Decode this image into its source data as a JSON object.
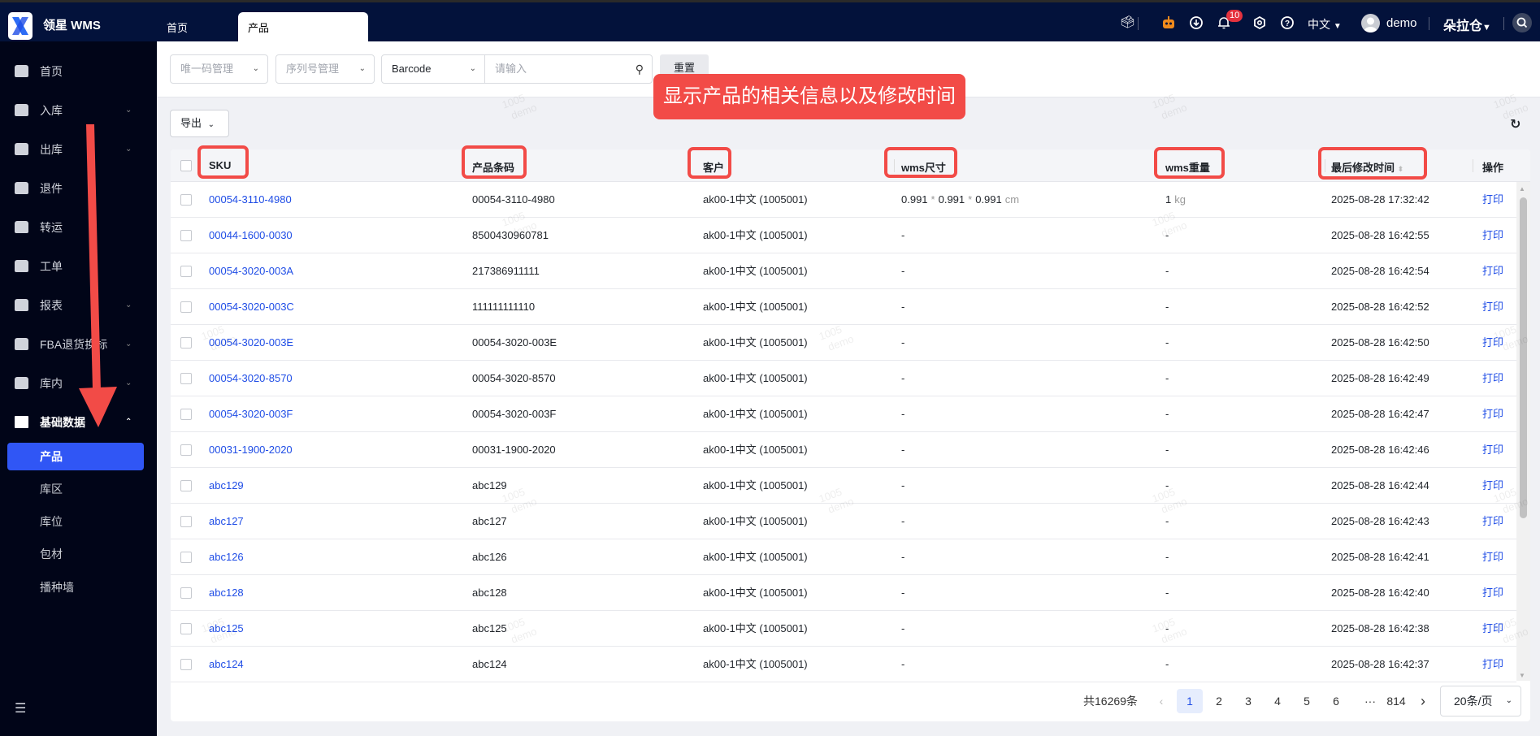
{
  "app": {
    "brand": "领星 WMS"
  },
  "tabs": [
    {
      "label": "首页"
    },
    {
      "label": "产品"
    }
  ],
  "header": {
    "notification_count": "10",
    "language": "中文",
    "username": "demo",
    "warehouse": "朵拉仓",
    "icons": [
      "inbox-icon",
      "robot-icon",
      "download-icon",
      "bell-icon",
      "settings-icon",
      "help-icon",
      "avatar",
      "search-icon"
    ]
  },
  "sidebar": {
    "items": [
      {
        "label": "首页"
      },
      {
        "label": "入库"
      },
      {
        "label": "出库"
      },
      {
        "label": "退件"
      },
      {
        "label": "转运"
      },
      {
        "label": "工单"
      },
      {
        "label": "报表"
      },
      {
        "label": "FBA退货换标"
      },
      {
        "label": "库内"
      },
      {
        "label": "基础数据"
      }
    ],
    "sub_items": [
      {
        "label": "产品"
      },
      {
        "label": "库区"
      },
      {
        "label": "库位"
      },
      {
        "label": "包材"
      },
      {
        "label": "播种墙"
      }
    ]
  },
  "filters": {
    "unique_code": "唯一码管理",
    "serial": "序列号管理",
    "field": "Barcode",
    "search_placeholder": "请输入",
    "reset": "重置"
  },
  "toolbar": {
    "export": "导出"
  },
  "table": {
    "columns": [
      "SKU",
      "产品条码",
      "客户",
      "wms尺寸",
      "wms重量",
      "最后修改时间",
      "操作"
    ],
    "rows": [
      {
        "sku": "00054-3110-4980",
        "barcode": "00054-3110-4980",
        "customer": "ak00-1中文 (1005001)",
        "size_l": "0.991",
        "size_w": "0.991",
        "size_h": "0.991",
        "size_unit": "cm",
        "weight": "1",
        "weight_unit": "kg",
        "time": "2025-08-28 17:32:42",
        "action": "打印"
      },
      {
        "sku": "00044-1600-0030",
        "barcode": "8500430960781",
        "customer": "ak00-1中文 (1005001)",
        "size": "-",
        "weight": "-",
        "time": "2025-08-28 16:42:55",
        "action": "打印"
      },
      {
        "sku": "00054-3020-003A",
        "barcode": "217386911111",
        "customer": "ak00-1中文 (1005001)",
        "size": "-",
        "weight": "-",
        "time": "2025-08-28 16:42:54",
        "action": "打印"
      },
      {
        "sku": "00054-3020-003C",
        "barcode": "111111111110",
        "customer": "ak00-1中文 (1005001)",
        "size": "-",
        "weight": "-",
        "time": "2025-08-28 16:42:52",
        "action": "打印"
      },
      {
        "sku": "00054-3020-003E",
        "barcode": "00054-3020-003E",
        "customer": "ak00-1中文 (1005001)",
        "size": "-",
        "weight": "-",
        "time": "2025-08-28 16:42:50",
        "action": "打印"
      },
      {
        "sku": "00054-3020-8570",
        "barcode": "00054-3020-8570",
        "customer": "ak00-1中文 (1005001)",
        "size": "-",
        "weight": "-",
        "time": "2025-08-28 16:42:49",
        "action": "打印"
      },
      {
        "sku": "00054-3020-003F",
        "barcode": "00054-3020-003F",
        "customer": "ak00-1中文 (1005001)",
        "size": "-",
        "weight": "-",
        "time": "2025-08-28 16:42:47",
        "action": "打印"
      },
      {
        "sku": "00031-1900-2020",
        "barcode": "00031-1900-2020",
        "customer": "ak00-1中文 (1005001)",
        "size": "-",
        "weight": "-",
        "time": "2025-08-28 16:42:46",
        "action": "打印"
      },
      {
        "sku": "abc129",
        "barcode": "abc129",
        "customer": "ak00-1中文 (1005001)",
        "size": "-",
        "weight": "-",
        "time": "2025-08-28 16:42:44",
        "action": "打印"
      },
      {
        "sku": "abc127",
        "barcode": "abc127",
        "customer": "ak00-1中文 (1005001)",
        "size": "-",
        "weight": "-",
        "time": "2025-08-28 16:42:43",
        "action": "打印"
      },
      {
        "sku": "abc126",
        "barcode": "abc126",
        "customer": "ak00-1中文 (1005001)",
        "size": "-",
        "weight": "-",
        "time": "2025-08-28 16:42:41",
        "action": "打印"
      },
      {
        "sku": "abc128",
        "barcode": "abc128",
        "customer": "ak00-1中文 (1005001)",
        "size": "-",
        "weight": "-",
        "time": "2025-08-28 16:42:40",
        "action": "打印"
      },
      {
        "sku": "abc125",
        "barcode": "abc125",
        "customer": "ak00-1中文 (1005001)",
        "size": "-",
        "weight": "-",
        "time": "2025-08-28 16:42:38",
        "action": "打印"
      },
      {
        "sku": "abc124",
        "barcode": "abc124",
        "customer": "ak00-1中文 (1005001)",
        "size": "-",
        "weight": "-",
        "time": "2025-08-28 16:42:37",
        "action": "打印"
      }
    ]
  },
  "pagination": {
    "total": "共16269条",
    "pages": [
      "1",
      "2",
      "3",
      "4",
      "5",
      "6"
    ],
    "ellipsis": "···",
    "last": "814",
    "current": "1",
    "page_size": "20条/页"
  },
  "watermark": {
    "line1": "1005",
    "line2": "demo"
  },
  "annotation": {
    "callout": "显示产品的相关信息以及修改时间",
    "color": "#f24b47"
  }
}
